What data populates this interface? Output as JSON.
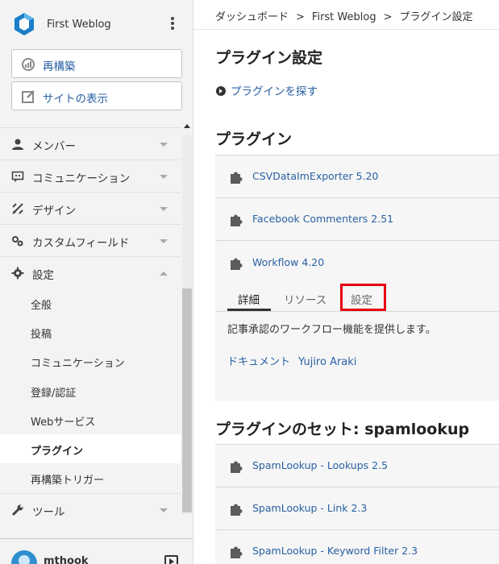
{
  "sidebar": {
    "site_name": "First Weblog",
    "buttons": {
      "rebuild": "再構築",
      "view_site": "サイトの表示"
    },
    "nav": [
      {
        "label": "メンバー",
        "icon": "user-icon"
      },
      {
        "label": "コミュニケーション",
        "icon": "comment-icon"
      },
      {
        "label": "デザイン",
        "icon": "design-icon"
      },
      {
        "label": "カスタムフィールド",
        "icon": "custom-field-icon"
      },
      {
        "label": "設定",
        "icon": "gear-icon"
      }
    ],
    "settings_sub": [
      "全般",
      "投稿",
      "コミュニケーション",
      "登録/認証",
      "Webサービス",
      "プラグイン",
      "再構築トリガー"
    ],
    "active_sub": "プラグイン",
    "tools": "ツール",
    "user": {
      "name": "mthook"
    }
  },
  "breadcrumb": [
    "ダッシュボード",
    "First Weblog",
    "プラグイン設定"
  ],
  "breadcrumb_sep": ">",
  "page_title": "プラグイン設定",
  "find_plugins": "プラグインを探す",
  "plugins_heading": "プラグイン",
  "plugins": [
    {
      "name": "CSVDataImExporter 5.20"
    },
    {
      "name": "Facebook Commenters 2.51"
    },
    {
      "name": "Workflow 4.20"
    }
  ],
  "expanded": {
    "tabs": [
      "詳細",
      "リソース",
      "設定"
    ],
    "active_tab": "詳細",
    "highlighted_tab": "設定",
    "description": "記事承認のワークフロー機能を提供します。",
    "doc_link": "ドキュメント",
    "author": "Yujiro Araki"
  },
  "set_heading": "プラグインのセット: spamlookup",
  "set_plugins": [
    {
      "name": "SpamLookup - Lookups 2.5"
    },
    {
      "name": "SpamLookup - Link 2.3"
    },
    {
      "name": "SpamLookup - Keyword Filter 2.3"
    }
  ],
  "colors": {
    "link": "#2960a3",
    "highlight": "#e60012",
    "sidebar_bg": "#f3f3f3",
    "panel_bg": "#f6f6f6"
  }
}
